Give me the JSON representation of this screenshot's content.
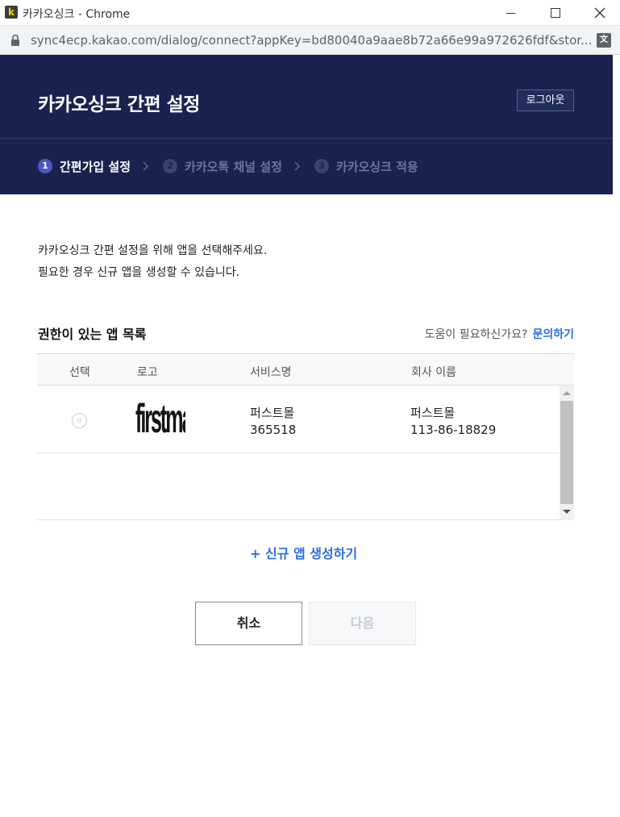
{
  "window": {
    "title": "카카오싱크 - Chrome",
    "favicon_letter": "k",
    "url": "sync4ecp.kakao.com/dialog/connect?appKey=bd80040a9aae8b72a66e99a972626fdf&stor..."
  },
  "header": {
    "title": "카카오싱크 간편 설정",
    "logout_label": "로그아웃",
    "steps": [
      {
        "num": "1",
        "label": "간편가입 설정",
        "active": true
      },
      {
        "num": "2",
        "label": "카카오톡 채널 설정",
        "active": false
      },
      {
        "num": "3",
        "label": "카카오싱크 적용",
        "active": false
      }
    ]
  },
  "intro": {
    "line1": "카카오싱크 간편 설정을 위해 앱을 선택해주세요.",
    "line2": "필요한 경우 신규 앱을 생성할 수 있습니다."
  },
  "apps_section": {
    "title": "권한이 있는 앱 목록",
    "help_text": "도움이 필요하신가요?",
    "help_link": "문의하기",
    "columns": {
      "select": "선택",
      "logo": "로고",
      "service": "서비스명",
      "company": "회사 이름"
    },
    "rows": [
      {
        "logo_text": "firstmall",
        "service_name": "퍼스트몰",
        "service_id": "365518",
        "company_name": "퍼스트몰",
        "company_number": "113-86-18829",
        "selected": false
      }
    ]
  },
  "create_app_label": "+ 신규 앱 생성하기",
  "buttons": {
    "cancel": "취소",
    "next": "다음"
  },
  "colors": {
    "header_bg": "#1a2350",
    "link": "#2a6ee8",
    "active_step": "#4a5bbd"
  }
}
